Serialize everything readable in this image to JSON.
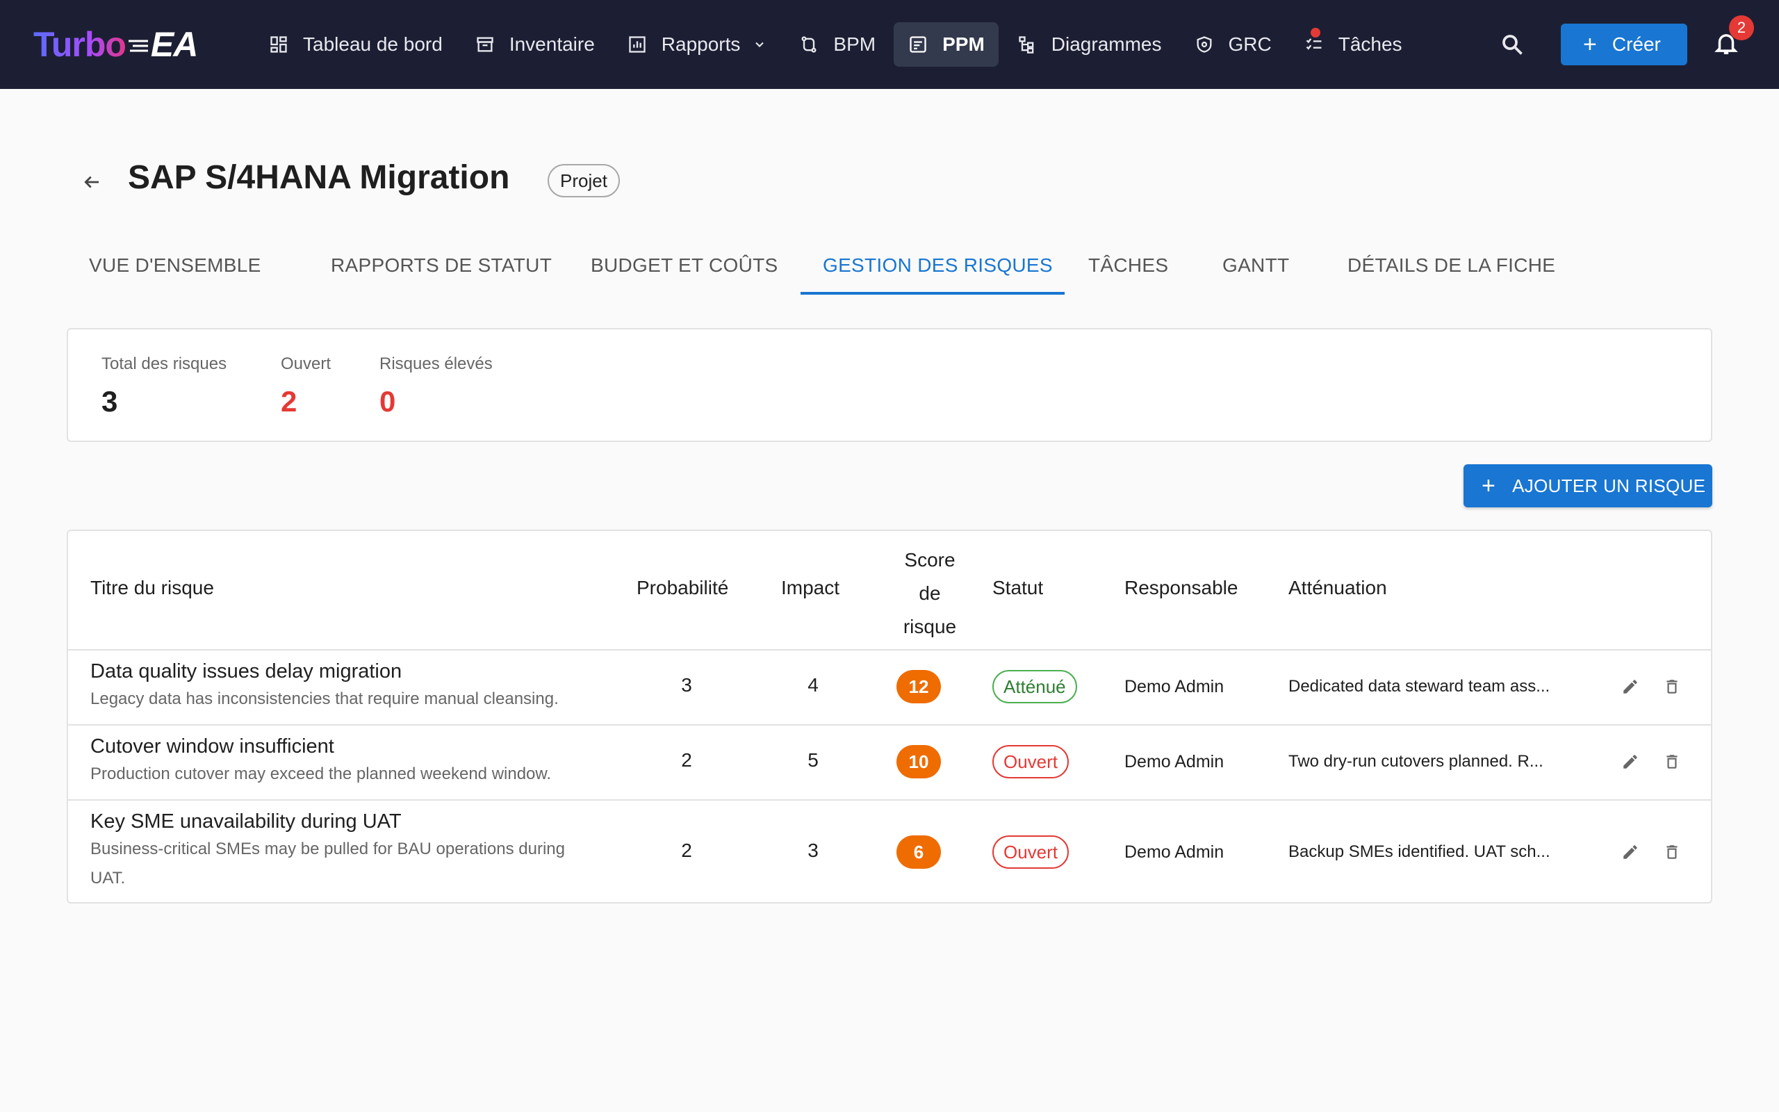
{
  "brand": {
    "part1": "Turbo",
    "part2": "EA"
  },
  "nav": {
    "items": [
      {
        "label": "Tableau de bord",
        "icon": "dashboard-icon"
      },
      {
        "label": "Inventaire",
        "icon": "inventory-icon"
      },
      {
        "label": "Rapports",
        "icon": "reports-icon"
      },
      {
        "label": "BPM",
        "icon": "bpm-icon"
      },
      {
        "label": "PPM",
        "icon": "ppm-icon"
      },
      {
        "label": "Diagrammes",
        "icon": "diagrams-icon"
      },
      {
        "label": "GRC",
        "icon": "grc-icon"
      },
      {
        "label": "Tâches",
        "icon": "tasks-icon"
      }
    ],
    "active": "PPM",
    "create_label": "Créer",
    "notification_count": "2"
  },
  "page": {
    "title": "SAP S/4HANA Migration",
    "type_chip": "Projet"
  },
  "tabs": [
    "VUE D'ENSEMBLE",
    "RAPPORTS DE STATUT",
    "BUDGET ET COÛTS",
    "GESTION DES RISQUES",
    "TÂCHES",
    "GANTT",
    "DÉTAILS DE LA FICHE"
  ],
  "active_tab": "GESTION DES RISQUES",
  "summary": {
    "total_label": "Total des risques",
    "total_value": "3",
    "open_label": "Ouvert",
    "open_value": "2",
    "high_label": "Risques élevés",
    "high_value": "0"
  },
  "add_risk_label": "AJOUTER UN RISQUE",
  "table": {
    "headers": {
      "title": "Titre du risque",
      "probability": "Probabilité",
      "impact": "Impact",
      "score_l1": "Score",
      "score_l2": "de",
      "score_l3": "risque",
      "status": "Statut",
      "owner": "Responsable",
      "mitigation": "Atténuation"
    },
    "rows": [
      {
        "title": "Data quality issues delay migration",
        "description": "Legacy data has inconsistencies that require manual cleansing.",
        "probability": "3",
        "impact": "4",
        "score": "12",
        "status": "Atténué",
        "owner": "Demo Admin",
        "mitigation": "Dedicated data steward team ass..."
      },
      {
        "title": "Cutover window insufficient",
        "description": "Production cutover may exceed the planned weekend window.",
        "probability": "2",
        "impact": "5",
        "score": "10",
        "status": "Ouvert",
        "owner": "Demo Admin",
        "mitigation": "Two dry-run cutovers planned. R..."
      },
      {
        "title": "Key SME unavailability during UAT",
        "description": "Business-critical SMEs may be pulled for BAU operations during UAT.",
        "probability": "2",
        "impact": "3",
        "score": "6",
        "status": "Ouvert",
        "owner": "Demo Admin",
        "mitigation": "Backup SMEs identified. UAT sch..."
      }
    ]
  },
  "colors": {
    "topbar": "#1c1f33",
    "primary": "#1976d2",
    "danger": "#e53935",
    "success": "#4caf50",
    "score": "#ef6c00"
  }
}
